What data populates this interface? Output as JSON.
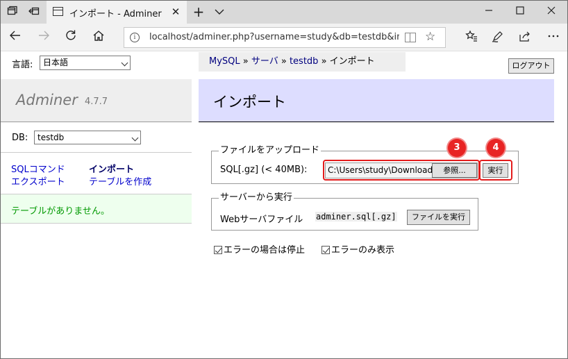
{
  "browser": {
    "tab_title": "インポート - Adminer",
    "url": "localhost/adminer.php?username=study&db=testdb&import=",
    "icons": [
      "tab-actions-icon",
      "set-tabs-aside-icon",
      "page-icon",
      "close-icon",
      "new-tab-icon",
      "tab-list-chevron-icon",
      "minimize-icon",
      "maximize-icon",
      "window-close-icon",
      "back-icon",
      "forward-icon",
      "refresh-icon",
      "home-icon",
      "info-icon",
      "reading-view-icon",
      "favorite-star-icon",
      "favorites-icon",
      "pen-icon",
      "share-icon",
      "more-icon"
    ]
  },
  "sidebar": {
    "lang_label": "言語:",
    "lang_value": "日本語",
    "brand": "Adminer",
    "version": "4.7.7",
    "db_label": "DB:",
    "db_value": "testdb",
    "links": {
      "sql_command": "SQLコマンド",
      "import": "インポート",
      "export": "エクスポート",
      "create_table": "テーブルを作成"
    },
    "no_tables": "テーブルがありません。"
  },
  "breadcrumb": {
    "mysql": "MySQL",
    "sep1": " » ",
    "server": "サーバ",
    "sep2": " » ",
    "db": "testdb",
    "sep3": " » ",
    "current": "インポート"
  },
  "logout_label": "ログアウト",
  "page_title": "インポート",
  "upload": {
    "legend": "ファイルをアップロード",
    "label": "SQL[.gz] (< 40MB):",
    "file_path": "C:\\Users\\study\\Download",
    "browse_label": "参照...",
    "execute_label": "実行"
  },
  "server_file": {
    "legend": "サーバーから実行",
    "label": "Webサーバファイル",
    "filename": "adminer.sql[.gz]",
    "run_label": "ファイルを実行"
  },
  "options": {
    "stop_on_error": "エラーの場合は停止",
    "only_errors": "エラーのみ表示"
  },
  "callouts": {
    "browse_step": "3",
    "execute_step": "4"
  },
  "colors": {
    "callout": "#e31b1b",
    "link": "#0000cc",
    "header_bg": "#ddddff",
    "notice_text": "#009900"
  }
}
